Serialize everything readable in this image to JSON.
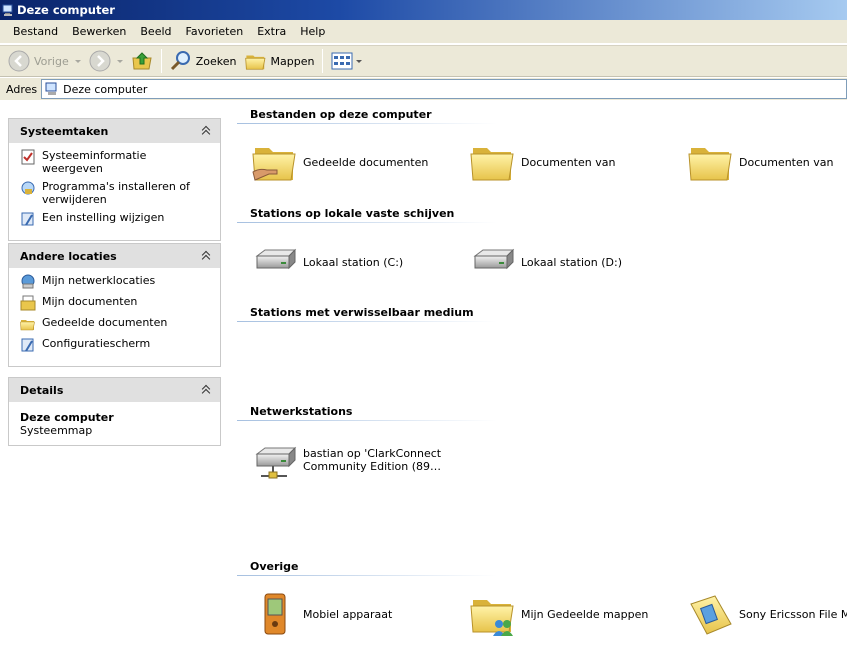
{
  "window": {
    "title": "Deze computer"
  },
  "menu": [
    "Bestand",
    "Bewerken",
    "Beeld",
    "Favorieten",
    "Extra",
    "Help"
  ],
  "toolbar": {
    "back_label": "Vorige",
    "search_label": "Zoeken",
    "folders_label": "Mappen"
  },
  "address": {
    "label": "Adres",
    "value": "Deze computer"
  },
  "sidebar": {
    "system_tasks": {
      "title": "Systeemtaken",
      "items": [
        "Systeeminformatie weergeven",
        "Programma's installeren of verwijderen",
        "Een instelling wijzigen"
      ]
    },
    "other_places": {
      "title": "Andere locaties",
      "items": [
        "Mijn netwerklocaties",
        "Mijn documenten",
        "Gedeelde documenten",
        "Configuratiescherm"
      ]
    },
    "details": {
      "title": "Details",
      "name": "Deze computer",
      "type": "Systeemmap"
    }
  },
  "groups": {
    "files": {
      "title": "Bestanden op deze computer",
      "items": [
        "Gedeelde documenten",
        "Documenten van",
        "Documenten van"
      ]
    },
    "local_drives": {
      "title": "Stations op lokale vaste schijven",
      "items": [
        "Lokaal station (C:)",
        "Lokaal station (D:)"
      ]
    },
    "removable": {
      "title": "Stations met verwisselbaar medium"
    },
    "network": {
      "title": "Netwerkstations",
      "items": [
        "bastian op 'ClarkConnect",
        "Community Edition (89…"
      ]
    },
    "other": {
      "title": "Overige",
      "items": [
        "Mobiel apparaat",
        "Mijn Gedeelde mappen",
        "Sony Ericsson File Manager"
      ]
    }
  }
}
